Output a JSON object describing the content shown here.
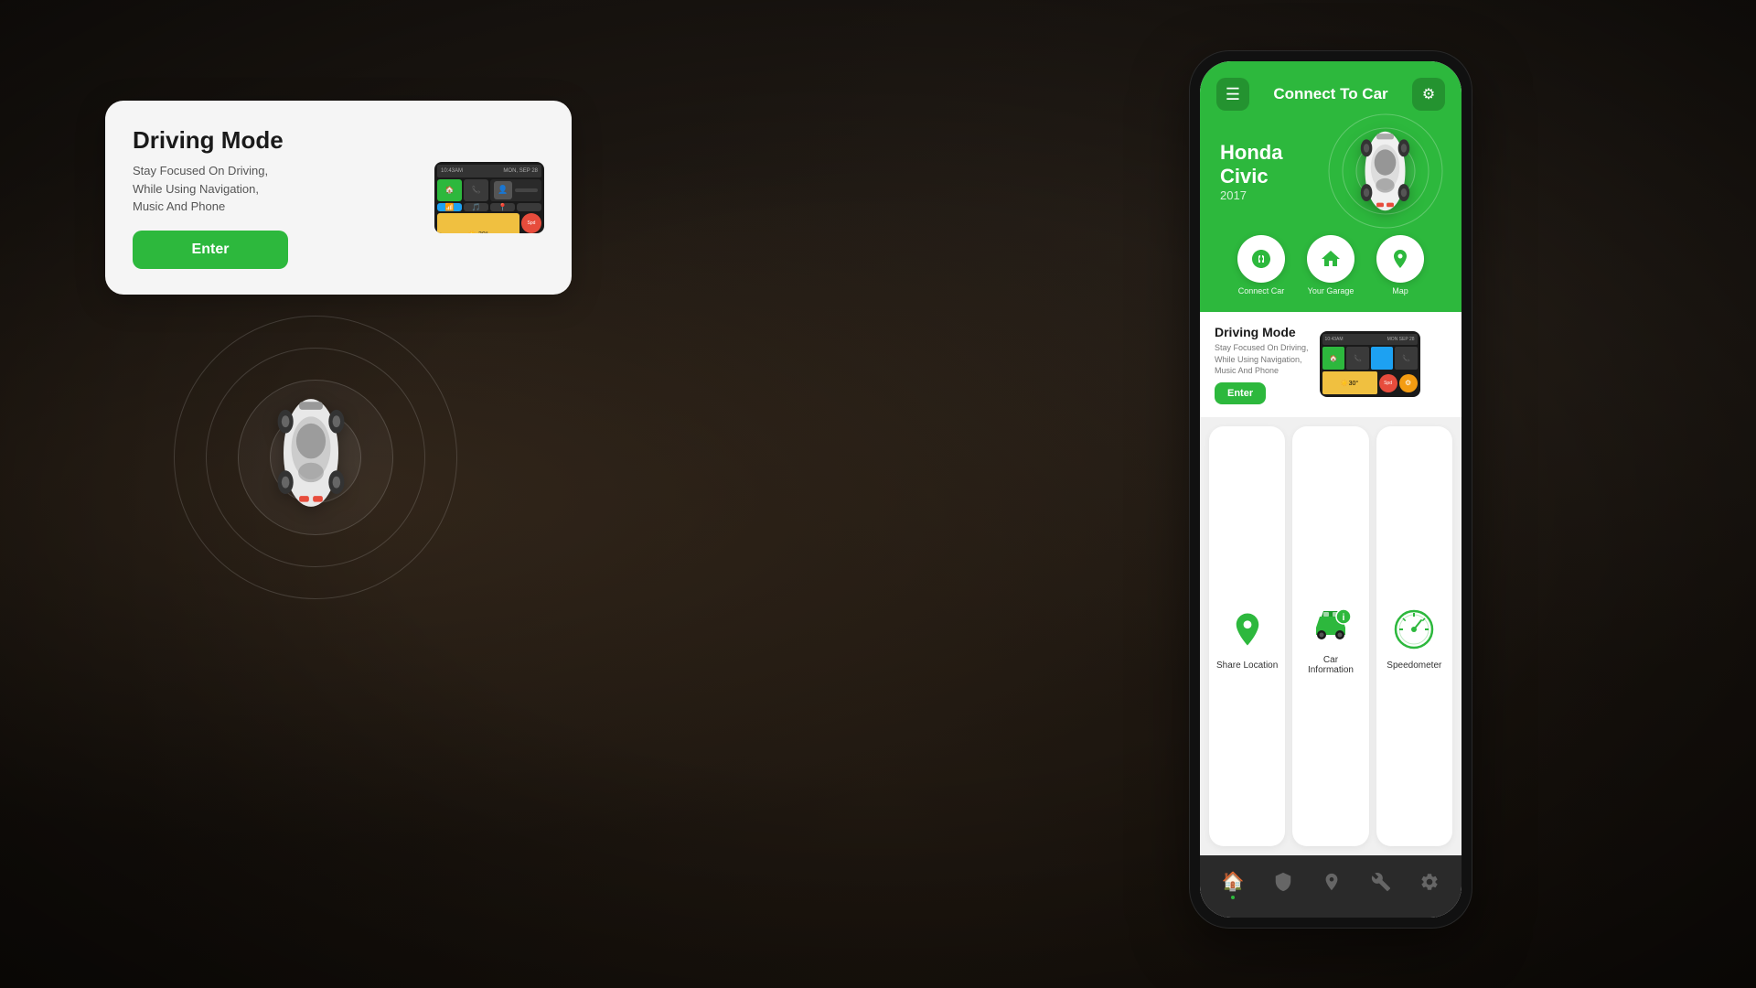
{
  "background": {
    "color": "#2a2018"
  },
  "driving_mode_card": {
    "title": "Driving Mode",
    "description": "Stay Focused On Driving,\nWhile Using Navigation,\nMusic And Phone",
    "enter_button": "Enter"
  },
  "car": {
    "name": "Honda Civic",
    "year": "2017"
  },
  "app": {
    "title": "Connect To Car",
    "menu_icon": "☰",
    "settings_icon": "⚙"
  },
  "quick_actions": [
    {
      "icon": "🔗",
      "label": "Connect Car"
    },
    {
      "icon": "🏠",
      "label": "Your Garage"
    },
    {
      "icon": "📍",
      "label": "Map"
    }
  ],
  "driving_mode": {
    "title": "Driving Mode",
    "description": "Stay Focused On Driving,\nWhile Using Navigation,\nMusic And Phone",
    "enter_label": "Enter"
  },
  "feature_cards": [
    {
      "icon": "📍",
      "label": "Share Location",
      "color": "#2db83d"
    },
    {
      "icon": "🚗",
      "label": "Car Information",
      "color": "#2db83d"
    },
    {
      "icon": "⏱",
      "label": "Speedometer",
      "color": "#2db83d"
    }
  ],
  "bottom_nav": [
    {
      "icon": "🏠",
      "active": true
    },
    {
      "icon": "🛡",
      "active": false
    },
    {
      "icon": "📍",
      "active": false
    },
    {
      "icon": "🔧",
      "active": false
    },
    {
      "icon": "⚙",
      "active": false
    }
  ]
}
